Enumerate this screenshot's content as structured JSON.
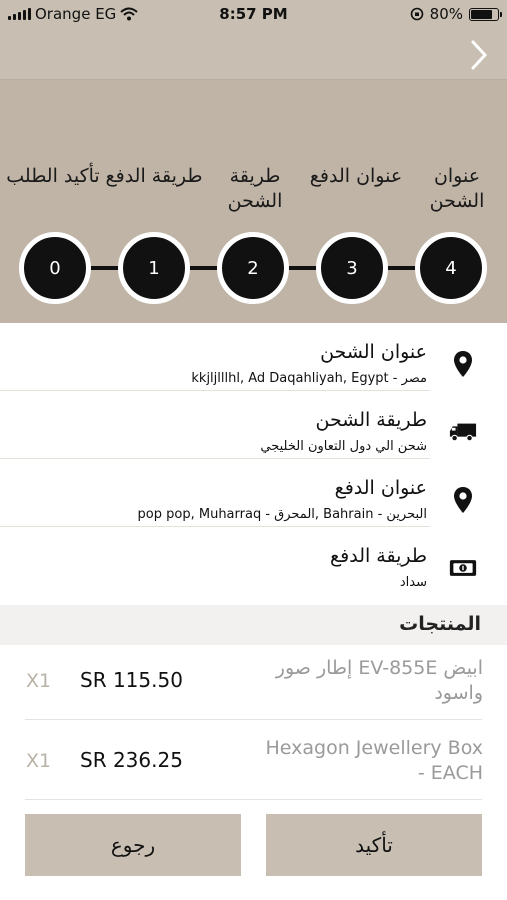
{
  "status_bar": {
    "carrier": "Orange EG",
    "time": "8:57 PM",
    "battery": "80%",
    "battery_level": 0.8
  },
  "steps": [
    {
      "label": "عنوان الشحن",
      "number": "4"
    },
    {
      "label": "عنوان الدفع",
      "number": "3"
    },
    {
      "label": "طريقة الشحن",
      "number": "2"
    },
    {
      "label": "طريقة الدفع",
      "number": "1"
    },
    {
      "label": "تأكيد الطلب",
      "number": "0"
    }
  ],
  "summary": [
    {
      "title": "عنوان الشحن",
      "detail": "kkjljlllhl, Ad Daqahliyah, Egypt - مصر",
      "icon": "location-pin-icon"
    },
    {
      "title": "طريقة الشحن",
      "detail": "شحن الي دول التعاون الخليجي",
      "icon": "truck-icon"
    },
    {
      "title": "عنوان الدفع",
      "detail": "pop pop, Muharraq - المحرق, Bahrain - البحرين",
      "icon": "location-pin-icon"
    },
    {
      "title": "طريقة الدفع",
      "detail": "سداد",
      "icon": "cash-icon"
    }
  ],
  "products": {
    "title": "المنتجات",
    "items": [
      {
        "qty": "X1",
        "price": "SR 115.50",
        "name": "إطار صور EV-855E ابيض واسود"
      },
      {
        "qty": "X1",
        "price": "SR 236.25",
        "name": "Hexagon Jewellery Box - EACH"
      }
    ]
  },
  "buttons": {
    "back": "رجوع",
    "confirm": "تأكيد"
  }
}
